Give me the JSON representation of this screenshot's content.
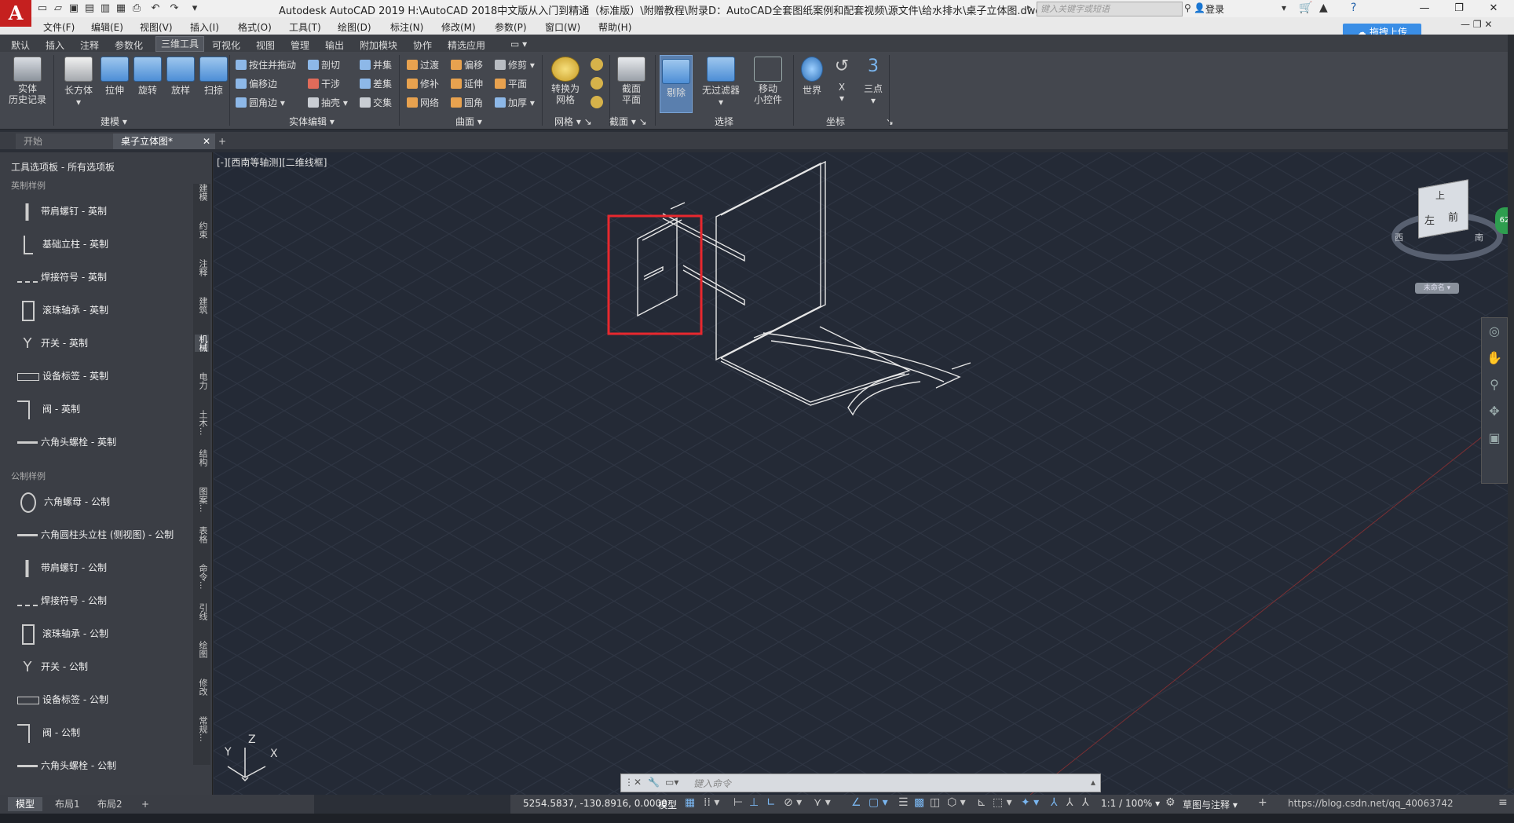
{
  "app": {
    "title": "Autodesk AutoCAD 2019    H:\\AutoCAD 2018中文版从入门到精通（标准版）\\附赠教程\\附录D：AutoCAD全套图纸案例和配套视频\\源文件\\给水排水\\桌子立体图.dwg",
    "logo": "A",
    "search_placeholder": "键入关键字或短语",
    "login": "登录",
    "upload": "拖拽上传"
  },
  "menu": [
    "文件(F)",
    "编辑(E)",
    "视图(V)",
    "插入(I)",
    "格式(O)",
    "工具(T)",
    "绘图(D)",
    "标注(N)",
    "修改(M)",
    "参数(P)",
    "窗口(W)",
    "帮助(H)"
  ],
  "ribbon_tabs": [
    "默认",
    "插入",
    "注释",
    "参数化",
    "三维工具",
    "可视化",
    "视图",
    "管理",
    "输出",
    "附加模块",
    "协作",
    "精选应用"
  ],
  "ribbon_active": "三维工具",
  "ribbon": {
    "history": "实体\n历史记录",
    "modeling": [
      "长方体",
      "拉伸",
      "旋转",
      "放样",
      "扫掠"
    ],
    "modeling_title": "建模",
    "solid_edit_small": [
      [
        "按住并拖动",
        "剖切",
        "并集"
      ],
      [
        "偏移边",
        "干涉",
        "差集"
      ],
      [
        "圆角边",
        "抽壳",
        "交集"
      ]
    ],
    "solid_edit_title": "实体编辑",
    "surface_small": [
      [
        "过渡",
        "偏移",
        "修剪"
      ],
      [
        "修补",
        "延伸",
        "平面"
      ],
      [
        "网络",
        "圆角",
        "加厚"
      ]
    ],
    "surface_title": "曲面",
    "mesh_btn": "转换为\n网格",
    "mesh_title": "网格",
    "section_btn": "截面\n平面",
    "section_title": "截面",
    "cull_btn": "剔除",
    "nofilter_btn": "无过滤器",
    "gizmo_btn": "移动\n小控件",
    "select_title": "选择",
    "world_btn": "世界",
    "x_btn": "X",
    "three_btn": "三点",
    "coord_title": "坐标"
  },
  "doc_tabs": [
    "开始",
    "桌子立体图*"
  ],
  "palette": {
    "title": "工具选项板 - 所有选项板",
    "section_imperial": "英制样例",
    "section_metric": "公制样例",
    "imperial": [
      "带肩螺钉 - 英制",
      "基础立柱 - 英制",
      "焊接符号 - 英制",
      "滚珠轴承 - 英制",
      "开关 - 英制",
      "设备标签 - 英制",
      "阀 - 英制",
      "六角头螺栓 - 英制"
    ],
    "metric": [
      "六角螺母 - 公制",
      "六角圆柱头立柱 (侧视图) - 公制",
      "带肩螺钉 - 公制",
      "焊接符号 - 公制",
      "滚珠轴承 - 公制",
      "开关 - 公制",
      "设备标签 - 公制",
      "阀 - 公制",
      "六角头螺栓 - 公制"
    ],
    "vtabs": [
      "建模",
      "约束",
      "注释",
      "建筑",
      "机械",
      "电力",
      "土木...",
      "结构",
      "图案...",
      "表格",
      "命令...",
      "引线",
      "绘图",
      "修改",
      "常规..."
    ]
  },
  "viewport": {
    "label": "[-][西南等轴测][二维线框]",
    "viewcube_top": "上",
    "viewcube_left": "左",
    "viewcube_front": "前",
    "compass_w": "西",
    "compass_s": "南",
    "ucs_name": "未命名",
    "badge": "62",
    "axis_x": "X",
    "axis_y": "Y",
    "axis_z": "Z",
    "highlight_color": "#e8282e"
  },
  "layout_tabs": [
    "模型",
    "布局1",
    "布局2"
  ],
  "status": {
    "coords": "5254.5837, -130.8916, 0.0000",
    "model": "模型",
    "scale": "1:1 / 100%",
    "workspace": "草图与注释",
    "watermark": "https://blog.csdn.net/qq_40063742"
  },
  "command_placeholder": "键入命令"
}
